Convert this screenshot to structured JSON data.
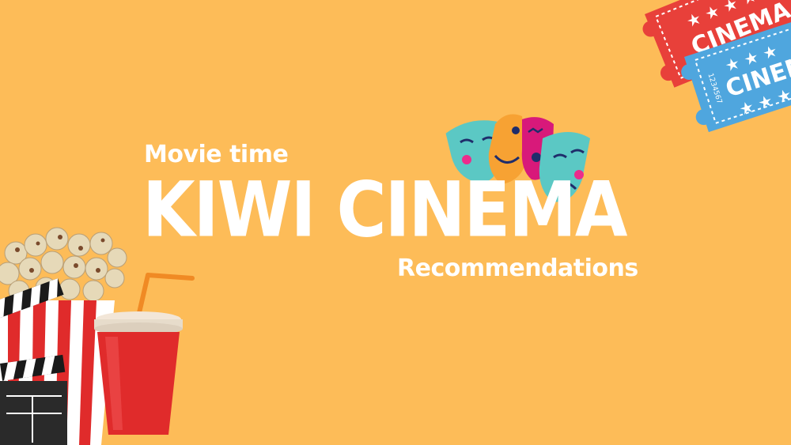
{
  "tagline": "Movie time",
  "title": "KIWI CINEMA",
  "subtitle": "Recommendations",
  "tickets": {
    "red_label": "CINEMA",
    "blue_label": "CINEMA",
    "serial": "1234567"
  },
  "colors": {
    "background": "#FDBC58",
    "text": "#FFFFFF",
    "ticket_red": "#E8403A",
    "ticket_blue": "#4FA6DE",
    "cup_red": "#E02B2B",
    "mask_teal": "#5BC8C4",
    "mask_orange": "#F7A233",
    "mask_magenta": "#D8197A"
  },
  "icons": [
    "cinema-ticket-icon",
    "theater-masks-icon",
    "popcorn-icon",
    "soda-cup-icon",
    "clapperboard-icon"
  ]
}
